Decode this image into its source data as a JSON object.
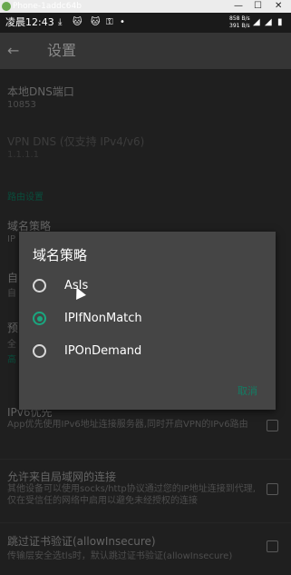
{
  "window": {
    "title": "Phone-1addc64b",
    "min": "—",
    "max": "☐",
    "close": "✕"
  },
  "status_bar": {
    "time": "凌晨12:43",
    "up": "858 B/s",
    "down": "391 B/s"
  },
  "toolbar": {
    "title": "设置"
  },
  "background": {
    "local_dns_port_title": "本地DNS端口",
    "local_dns_port_value": "10853",
    "vpn_dns_title": "VPN DNS (仅支持 IPv4/v6)",
    "vpn_dns_value": "1.1.1.1",
    "routing_section": "路由设置",
    "domain_strategy_title": "域名策略",
    "domain_strategy_value": "IP",
    "row_a_title": "自",
    "row_a_sum": "自",
    "row_b_title": "预",
    "row_b_sum": "全",
    "row_c_section": "高",
    "ipv6_title": "IPv6优先",
    "ipv6_sum": "App优先使用IPv6地址连接服务器,同时开启VPN的IPv6路由",
    "lan_title": "允许来自局域网的连接",
    "lan_sum": "其他设备可以使用socks/http协议通过您的IP地址连接到代理,仅在受信任的网络中启用以避免未经授权的连接",
    "insecure_title": "跳过证书验证(allowInsecure)",
    "insecure_sum": "传输层安全选tls时，默认跳过证书验证(allowInsecure)"
  },
  "dialog": {
    "title": "域名策略",
    "options": [
      {
        "label": "AsIs",
        "selected": false
      },
      {
        "label": "IPIfNonMatch",
        "selected": true
      },
      {
        "label": "IPOnDemand",
        "selected": false
      }
    ],
    "cancel": "取消"
  },
  "colors": {
    "accent": "#1aa67f",
    "dialog_bg": "#454545",
    "page_bg": "#262626"
  }
}
